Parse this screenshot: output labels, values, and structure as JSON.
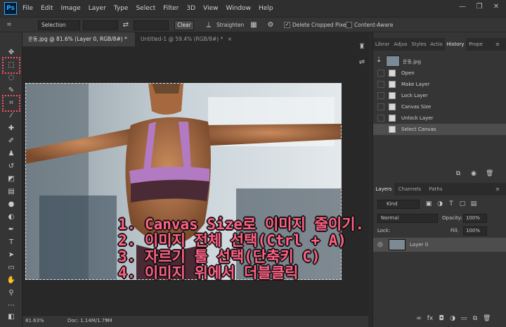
{
  "app": {
    "logo": "Ps"
  },
  "menu": [
    "File",
    "Edit",
    "Image",
    "Layer",
    "Type",
    "Select",
    "Filter",
    "3D",
    "View",
    "Window",
    "Help"
  ],
  "window_controls": [
    "—",
    "❐",
    "✕"
  ],
  "options": {
    "ratio_value": "Selection",
    "clear_label": "Clear",
    "straighten_label": "Straighten",
    "delete_cropped_label": "Delete Cropped Pixels",
    "delete_cropped_checked": true,
    "content_aware_label": "Content-Aware",
    "content_aware_checked": false
  },
  "tabs": [
    {
      "label": "운동.jpg @ 81.6% (Layer 0, RGB/8#) *",
      "active": true
    },
    {
      "label": "Untitled-1 @ 59.4% (RGB/8#) *",
      "active": false
    }
  ],
  "status": {
    "zoom": "81.63%",
    "doc": "Doc: 1.14M/1.79M"
  },
  "right_tabs_top": [
    "Librar",
    "Adjus",
    "Styles",
    "Actio",
    "History",
    "Prope"
  ],
  "history": {
    "snapshot_label": "운동.jpg",
    "items": [
      "Open",
      "Make Layer",
      "Lock Layer",
      "Canvas Size",
      "Unlock Layer",
      "Select Canvas"
    ]
  },
  "layers_tabs": [
    "Layers",
    "Channels",
    "Paths"
  ],
  "layers": {
    "kind_label": "Kind",
    "blend_mode": "Normal",
    "opacity_label": "Opacity:",
    "opacity_value": "100%",
    "lock_label": "Lock:",
    "fill_label": "Fill:",
    "fill_value": "100%",
    "layer_name": "Layer 0"
  },
  "instructions": [
    "1. Canvas Size로 이미지 줄이기.",
    "2. 이미지 전체 선택(Ctrl + A)",
    "3. 자르기 툴 선택(단축키 C)",
    "4. 이미지 위에서 더블클릭"
  ],
  "colors": {
    "accent": "#31a8ff",
    "highlight": "#ff4f6b",
    "overlay_text": "#ff5f83"
  }
}
